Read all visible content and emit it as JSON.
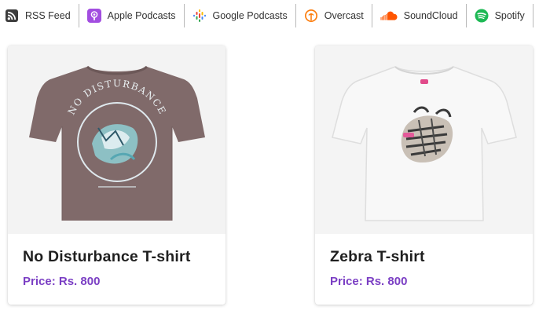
{
  "podcast_links": [
    {
      "label": "RSS Feed",
      "icon": "rss-icon",
      "color": "#444444"
    },
    {
      "label": "Apple Podcasts",
      "icon": "apple-podcasts-icon",
      "color": "#9b4fd9"
    },
    {
      "label": "Google Podcasts",
      "icon": "google-podcasts-icon",
      "color": "#fbbc04"
    },
    {
      "label": "Overcast",
      "icon": "overcast-icon",
      "color": "#fc7e0f"
    },
    {
      "label": "SoundCloud",
      "icon": "soundcloud-icon",
      "color": "#ff5500"
    },
    {
      "label": "Spotify",
      "icon": "spotify-icon",
      "color": "#1db954"
    }
  ],
  "products": [
    {
      "name": "No Disturbance T-shirt",
      "price_label": "Price:",
      "price": "Rs. 800",
      "print_text": "NO DISTURBANCE"
    },
    {
      "name": "Zebra T-shirt",
      "price_label": "Price:",
      "price": "Rs. 800"
    }
  ],
  "colors": {
    "price": "#7b3fc4",
    "brown_shirt": "#806a6a",
    "white_shirt": "#f7f7f7"
  }
}
